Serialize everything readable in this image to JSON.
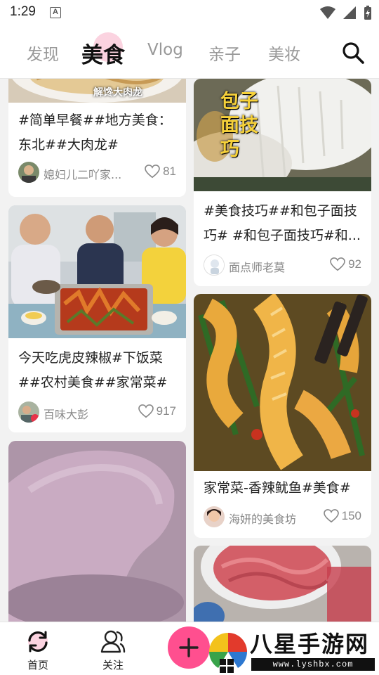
{
  "status": {
    "time": "1:29",
    "indicator": "A"
  },
  "tabs": [
    {
      "label": "发现"
    },
    {
      "label": "美食"
    },
    {
      "label": "Vlog"
    },
    {
      "label": "亲子"
    },
    {
      "label": "美妆"
    }
  ],
  "cards": [
    {
      "image_caption": "解馋大肉龙",
      "title": "#简单早餐##地方美食：东北##大肉龙#",
      "author": "媳妇儿二吖家...",
      "likes": "81"
    },
    {
      "image_caption": "包子面技巧",
      "title": "#美食技巧##和包子面技巧# #和包子面技巧#和...",
      "author": "面点师老莫",
      "likes": "92"
    },
    {
      "title": "今天吃虎皮辣椒#下饭菜##农村美食##家常菜#",
      "author": "百味大彭",
      "likes": "917"
    },
    {
      "title": "家常菜-香辣鱿鱼#美食#",
      "author": "海妍的美食坊",
      "likes": "150"
    }
  ],
  "bottom_nav": [
    {
      "label": "首页"
    },
    {
      "label": "关注"
    }
  ],
  "watermark": {
    "text": "八星手游网",
    "url": "www.lyshbx.com"
  },
  "colors": {
    "accent": "#ff4f8f",
    "tab_highlight": "#fbd3e0",
    "text": "#222222",
    "muted": "#888888"
  }
}
